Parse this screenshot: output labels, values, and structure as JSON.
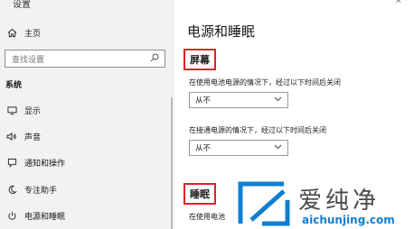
{
  "window": {
    "title": "设置",
    "close_glyph": "×"
  },
  "sidebar": {
    "home_label": "主页",
    "search_placeholder": "查找设置",
    "section_label": "系统",
    "items": [
      {
        "label": "显示",
        "icon": "monitor-icon"
      },
      {
        "label": "声音",
        "icon": "speaker-icon"
      },
      {
        "label": "通知和操作",
        "icon": "notification-icon"
      },
      {
        "label": "专注助手",
        "icon": "moon-icon"
      },
      {
        "label": "电源和睡眠",
        "icon": "power-icon"
      }
    ]
  },
  "main": {
    "title": "电源和睡眠",
    "screen": {
      "heading": "屏幕",
      "battery_desc": "在使用电池电源的情况下，经过以下时间后关闭",
      "battery_value": "从不",
      "plugged_desc": "在接通电源的情况下，经过以下时间后关闭",
      "plugged_value": "从不"
    },
    "sleep": {
      "heading": "睡眠",
      "battery_desc": "在使用电池"
    }
  },
  "watermark": {
    "text_cn": "爱纯净",
    "text_en": "aichunjing.com"
  },
  "colors": {
    "highlight_border": "#e0202a",
    "watermark_blue": "#0f7fd1",
    "sidebar_bg": "#f2f2f2"
  }
}
